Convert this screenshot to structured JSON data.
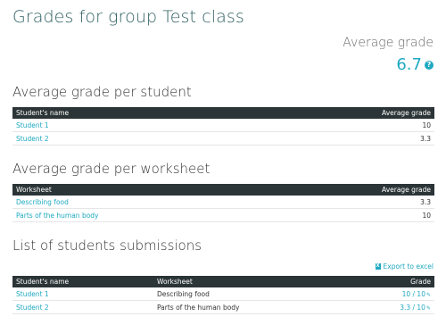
{
  "page_title": "Grades for group Test class",
  "average": {
    "label": "Average grade",
    "value": "6.7",
    "help_icon": "question-circle-icon"
  },
  "per_student": {
    "title": "Average grade per student",
    "columns": [
      "Student's name",
      "Average grade"
    ],
    "rows": [
      {
        "name": "Student 1",
        "grade": "10"
      },
      {
        "name": "Student 2",
        "grade": "3.3"
      }
    ]
  },
  "per_worksheet": {
    "title": "Average grade per worksheet",
    "columns": [
      "Worksheet",
      "Average grade"
    ],
    "rows": [
      {
        "name": "Describing food",
        "grade": "3.3"
      },
      {
        "name": "Parts of the human body",
        "grade": "10"
      }
    ]
  },
  "submissions": {
    "title": "List of students submissions",
    "export_label": "Export to excel",
    "export_icon": "excel-icon",
    "columns": [
      "Student's name",
      "Worksheet",
      "Grade"
    ],
    "rows": [
      {
        "name": "Student 1",
        "worksheet": "Describing food",
        "grade": "10 / 10"
      },
      {
        "name": "Student 2",
        "worksheet": "Parts of the human body",
        "grade": "3.3 / 10"
      }
    ]
  },
  "colors": {
    "accent": "#1fa9c2",
    "header_bg": "#2b3436",
    "title": "#2f5f62"
  }
}
